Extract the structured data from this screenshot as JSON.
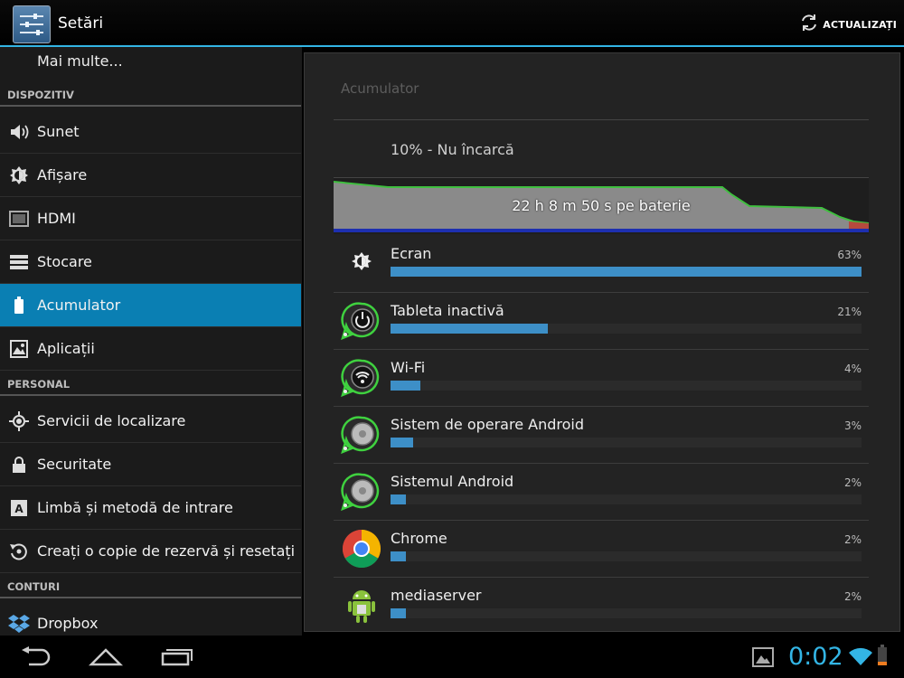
{
  "action_bar": {
    "title": "Setări",
    "refresh_label": "ACTUALIZAȚI"
  },
  "settings": {
    "more_label": "Mai multe...",
    "sections": [
      {
        "header": "DISPOZITIV",
        "items": [
          {
            "label": "Sunet",
            "icon": "speaker-icon"
          },
          {
            "label": "Afișare",
            "icon": "brightness-icon"
          },
          {
            "label": "HDMI",
            "icon": "hdmi-icon"
          },
          {
            "label": "Stocare",
            "icon": "storage-icon"
          },
          {
            "label": "Acumulator",
            "icon": "battery-icon",
            "selected": true
          },
          {
            "label": "Aplicații",
            "icon": "apps-icon"
          }
        ]
      },
      {
        "header": "PERSONAL",
        "items": [
          {
            "label": "Servicii de localizare",
            "icon": "location-icon"
          },
          {
            "label": "Securitate",
            "icon": "lock-icon"
          },
          {
            "label": "Limbă și metodă de intrare",
            "icon": "keyboard-icon"
          },
          {
            "label": "Creați o copie de rezervă și resetați",
            "icon": "backup-icon"
          }
        ]
      },
      {
        "header": "CONTURI",
        "items": [
          {
            "label": "Dropbox",
            "icon": "dropbox-icon"
          }
        ]
      }
    ]
  },
  "battery": {
    "title": "Acumulator",
    "status": "10% - Nu încarcă",
    "graph_label": "22 h 8 m 50 s pe baterie",
    "usage": [
      {
        "name": "Ecran",
        "percent_label": "63%",
        "percent": 63,
        "icon": "brightness-icon"
      },
      {
        "name": "Tableta inactivă",
        "percent_label": "21%",
        "percent": 21,
        "icon": "power-icon"
      },
      {
        "name": "Wi-Fi",
        "percent_label": "4%",
        "percent": 4,
        "icon": "wifi-icon"
      },
      {
        "name": "Sistem de operare Android",
        "percent_label": "3%",
        "percent": 3,
        "icon": "android-os-icon"
      },
      {
        "name": "Sistemul Android",
        "percent_label": "2%",
        "percent": 2,
        "icon": "android-system-icon"
      },
      {
        "name": "Chrome",
        "percent_label": "2%",
        "percent": 2,
        "icon": "chrome-icon"
      },
      {
        "name": "mediaserver",
        "percent_label": "2%",
        "percent": 2,
        "icon": "android-robot-icon"
      }
    ]
  },
  "system_bar": {
    "clock": "0:02"
  },
  "colors": {
    "accent": "#33b5e5",
    "selected": "#0a7fb3",
    "bar": "#3d8fc7"
  }
}
